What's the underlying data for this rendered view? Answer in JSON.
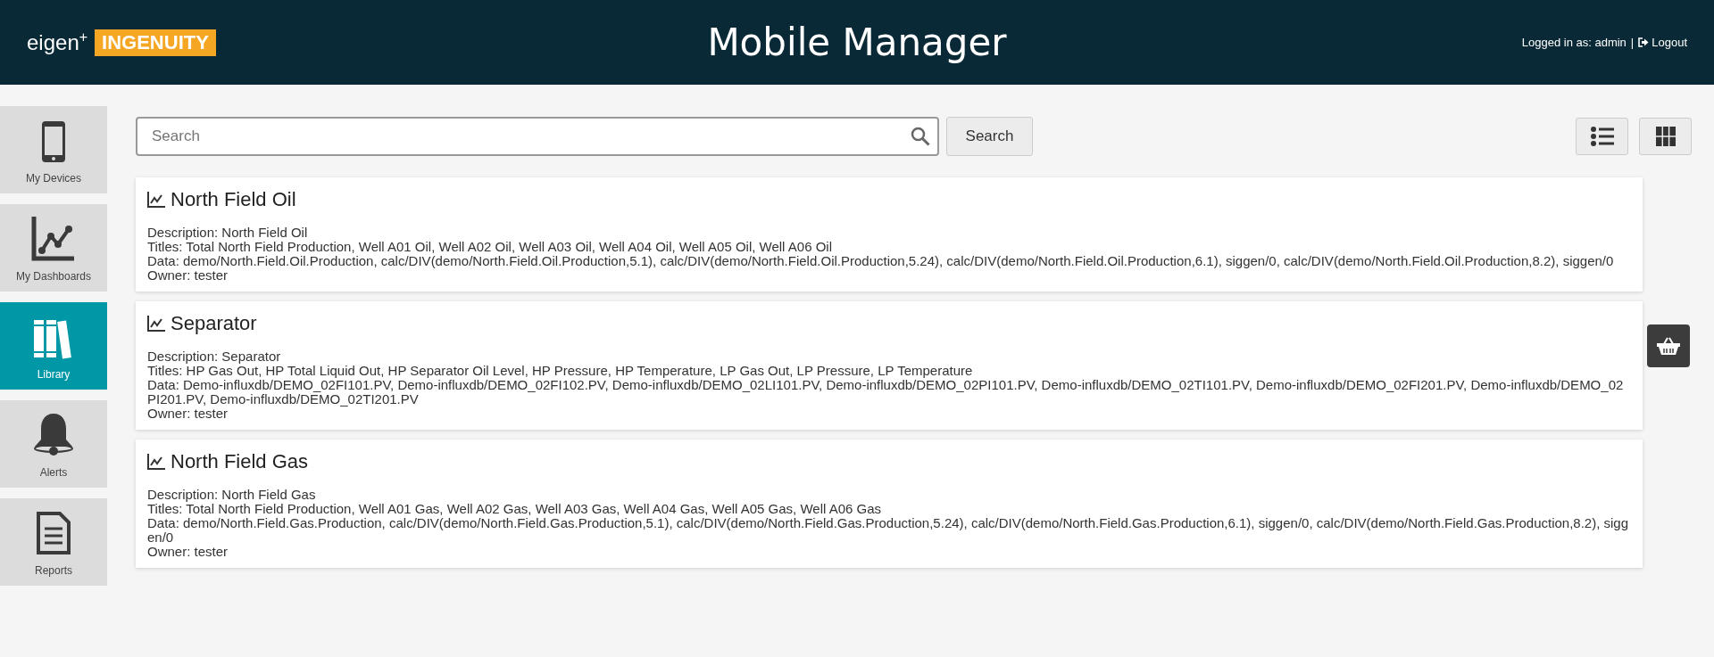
{
  "header": {
    "logo_text": "eigen$^{+}$",
    "logo_badge": "INGENUITY",
    "title": "Mobile Manager",
    "user_label": "Logged in as: admin",
    "separator": "|",
    "logout": "Logout"
  },
  "sidebar": {
    "items": [
      {
        "kind": "devices",
        "label": "My Devices",
        "selected": false
      },
      {
        "kind": "dashboards",
        "label": "My Dashboards",
        "selected": false
      },
      {
        "kind": "library",
        "label": "Library",
        "selected": true
      },
      {
        "kind": "alerts",
        "label": "Alerts",
        "selected": false
      },
      {
        "kind": "reports",
        "label": "Reports",
        "selected": false
      }
    ]
  },
  "search": {
    "placeholder": "Search",
    "button": "Search"
  },
  "view_buttons": [
    {
      "kind": "list",
      "selected": false
    },
    {
      "kind": "grid",
      "selected": false
    }
  ],
  "items": [
    {
      "title": "North Field Oil",
      "lines": [
        "Description: North Field Oil",
        "Titles: Total North Field Production, Well A01 Oil, Well A02 Oil, Well A03 Oil, Well A04 Oil, Well A05 Oil, Well A06 Oil",
        "Data: demo/North.Field.Oil.Production, calc/DIV(demo/North.Field.Oil.Production,5.1), calc/DIV(demo/North.Field.Oil.Production,5.24), calc/DIV(demo/North.Field.Oil.Production,6.1), siggen/0, calc/DIV(demo/North.Field.Oil.Production,8.2), siggen/0",
        "Owner: tester"
      ]
    },
    {
      "title": "Separator",
      "lines": [
        "Description: Separator",
        "Titles: HP Gas Out, HP Total Liquid Out, HP Separator Oil Level, HP Pressure, HP Temperature, LP Gas Out, LP Pressure, LP Temperature",
        "Data: Demo-influxdb/DEMO_02FI101.PV, Demo-influxdb/DEMO_02FI102.PV, Demo-influxdb/DEMO_02LI101.PV, Demo-influxdb/DEMO_02PI101.PV, Demo-influxdb/DEMO_02TI101.PV, Demo-influxdb/DEMO_02FI201.PV, Demo-influxdb/DEMO_02PI201.PV, Demo-influxdb/DEMO_02TI201.PV",
        "Owner: tester"
      ]
    },
    {
      "title": "North Field Gas",
      "lines": [
        "Description: North Field Gas",
        "Titles: Total North Field Production, Well A01 Gas, Well A02 Gas, Well A03 Gas, Well A04 Gas, Well A05 Gas, Well A06 Gas",
        "Data: demo/North.Field.Gas.Production, calc/DIV(demo/North.Field.Gas.Production,5.1), calc/DIV(demo/North.Field.Gas.Production,5.24), calc/DIV(demo/North.Field.Gas.Production,6.1), siggen/0, calc/DIV(demo/North.Field.Gas.Production,8.2), siggen/0",
        "Owner: tester"
      ]
    }
  ]
}
